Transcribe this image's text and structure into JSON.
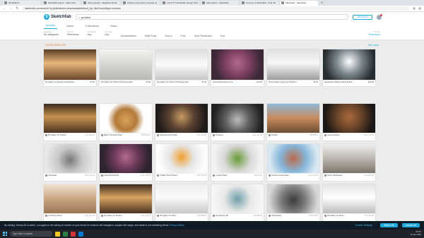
{
  "browser": {
    "tabs": [
      "3D Platform",
      "Sketchfab Figure - Sales Res",
      "Video Design - Wayback Studio",
      "Chatbot Instructions and also ai",
      "Lulu PT 5 Sketchfab Design Phase",
      "Submission - Sketchfab",
      "Connect to Sketchfab - Find 3D",
      "Sketchfab - Sketchfab"
    ],
    "active_tab": 7,
    "url": "sketchfab.com/search?q=pr&features=downloadable&sort_by=-likeCount&type=models"
  },
  "header": {
    "logo": "Sketchfab",
    "search_value": "product",
    "upload": "UPLOAD"
  },
  "tabs": [
    "Models",
    "Users",
    "Collections",
    "Store"
  ],
  "filters": [
    {
      "label": "Category",
      "value": "All categories"
    },
    {
      "label": "Sort by",
      "value": "Relevance"
    },
    {
      "label": "Animated",
      "value": "Any"
    },
    {
      "label": "License",
      "value": "Any"
    }
  ],
  "checks": [
    "Downloadable",
    "Staff Picks",
    "Sound",
    "Free",
    "Store Restricted",
    "Sort"
  ],
  "sort": {
    "label": "Sort by",
    "value": "Relevance"
  },
  "sections": {
    "store": "STORE RESULTS",
    "see_all": "See more"
  },
  "store_cards": [
    {
      "name": "3D Gallery for Product and Painting",
      "price": "$7.99"
    },
    {
      "name": "3D Gallery for Product Showcase 2023",
      "price": "$7.99"
    },
    {
      "name": "3D Gallery for Product Showcase 2023",
      "price": "$7.99"
    },
    {
      "name": "Assembled Mecha Armor",
      "price": "$10.00"
    },
    {
      "name": "Virtual Gallery Scene for Product 2",
      "price": "$7.99"
    },
    {
      "name": "Hexahedron White Product Exhibit",
      "price": "$12.99"
    }
  ],
  "model_cards": [
    {
      "name": "3D Gallery for Product",
      "stats": "1.2k  2.0k  31"
    },
    {
      "name": "Bakery Products Pack",
      "stats": "4.9k  620  14"
    },
    {
      "name": "Industrial Loft Product",
      "stats": "1.4k  1.5k  55"
    },
    {
      "name": "Turbulent",
      "stats": "1.8k  1.2k  42"
    },
    {
      "name": "Product",
      "stats": "500  85  24"
    },
    {
      "name": "Carved Dragon",
      "stats": "2.3k  1.1k  70"
    },
    {
      "name": "Streetwear",
      "stats": "1.9k  1.1k  34"
    },
    {
      "name": "Assembled Mecha",
      "stats": "1.4k  1.3k  51"
    },
    {
      "name": "CNHEL Shoe Product",
      "stats": "1.5k  1.0k  29"
    },
    {
      "name": "Lowpoly Mesh",
      "stats": "900  62  12"
    },
    {
      "name": "Cartoon House Stack",
      "stats": "1.2k  1.1k  53"
    },
    {
      "name": "Interior Bookcases",
      "stats": "1.1k  980  16"
    },
    {
      "name": "Loft Dining Room",
      "stats": "1.3k  1.2k  44"
    },
    {
      "name": "3D Gallery for Product",
      "stats": "1.2k  1.0k  21"
    },
    {
      "name": "3D Gallery for Room",
      "stats": "1.5k  980  19"
    },
    {
      "name": "Hemisphere 3D",
      "stats": "1.2k  820  26"
    },
    {
      "name": "VR Headset",
      "stats": "1.0k  910  33"
    },
    {
      "name": "3D Gallery for Room",
      "stats": "1.1k  760  18"
    },
    {
      "name": "Photogram Scan",
      "stats": "1.4k  930  27"
    }
  ],
  "cookie": {
    "text": "By clicking \"Accept All Cookies\", you agree to the storing of cookies on your device to enhance site navigation, analyze site usage, and assist in our marketing efforts.",
    "link": "Privacy Notice",
    "settings": "Cookie Settings",
    "reject": "Reject All",
    "accept": "Accept All"
  },
  "taskbar": {
    "search": "Type here to search",
    "time": "09:51",
    "date": "22-02-2023"
  }
}
